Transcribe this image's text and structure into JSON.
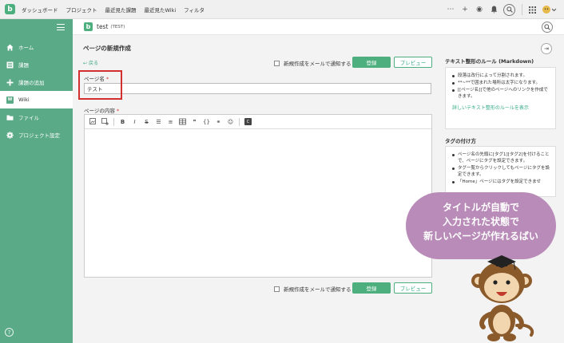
{
  "topbar": {
    "nav": [
      "ダッシュボード",
      "プロジェクト",
      "最近見た課題",
      "最近見たWiki",
      "フィルタ"
    ]
  },
  "sidebar": {
    "items": [
      {
        "label": "ホーム",
        "icon": "home-icon"
      },
      {
        "label": "課題",
        "icon": "list-icon"
      },
      {
        "label": "課題の追加",
        "icon": "plus-icon"
      },
      {
        "label": "Wiki",
        "icon": "wiki-icon",
        "active": true
      },
      {
        "label": "ファイル",
        "icon": "folder-icon"
      },
      {
        "label": "プロジェクト設定",
        "icon": "gear-icon"
      }
    ],
    "help_label": "?"
  },
  "project": {
    "name": "test",
    "key": "(TEST)",
    "icon_letter": "b"
  },
  "page": {
    "title": "ページの新規作成",
    "back_label": "戻る",
    "notify_label": "新規作成をメールで通知する",
    "save_label": "登録",
    "preview_label": "プレビュー",
    "page_name_label": "ページ名",
    "page_name_value": "テスト",
    "content_label": "ページの内容",
    "required_mark": "*"
  },
  "markdown_rules": {
    "title": "テキスト整形のルール (Markdown)",
    "items": [
      "段落は改行によって分割されます。",
      "**~**で囲まれた場所は太字になります。",
      "[[ページ名]]で他のページへのリンクを作成できます。"
    ],
    "link": "詳しいテキスト整形のルールを表示"
  },
  "tags": {
    "title": "タグの付け方",
    "items": [
      "ページ名の先頭に[タグ1][タグ2]を付けることで、ページにタグを設定できます。",
      "タグ一覧からクリックしてもページにタグを設定できます。",
      "「Home」ページにはタグを設定できませ"
    ]
  },
  "bubble": {
    "lines": [
      "タイトルが自動で",
      "入力された状態で",
      "新しいページが作れるばい"
    ]
  },
  "colors": {
    "brand_green": "#4caf7d",
    "sidebar_green": "#5aa987",
    "highlight_red": "#d32f2f",
    "bubble_purple": "#b98bb8"
  }
}
